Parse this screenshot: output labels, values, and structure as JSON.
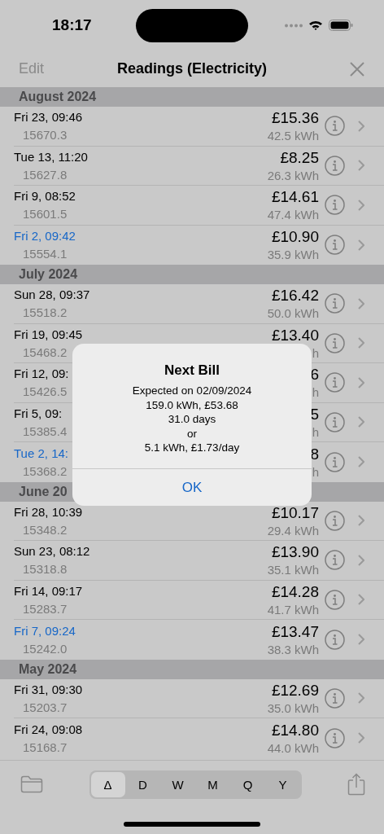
{
  "status_bar": {
    "time": "18:17"
  },
  "nav": {
    "edit": "Edit",
    "title": "Readings (Electricity)"
  },
  "sections": [
    {
      "title": "August 2024",
      "rows": [
        {
          "date": "Fri 23, 09:46",
          "reading": "15670.3",
          "amount": "£15.36",
          "usage": "42.5 kWh",
          "marked": false
        },
        {
          "date": "Tue 13, 11:20",
          "reading": "15627.8",
          "amount": "£8.25",
          "usage": "26.3 kWh",
          "marked": false
        },
        {
          "date": "Fri 9, 08:52",
          "reading": "15601.5",
          "amount": "£14.61",
          "usage": "47.4 kWh",
          "marked": false
        },
        {
          "date": "Fri 2, 09:42",
          "reading": "15554.1",
          "amount": "£10.90",
          "usage": "35.9 kWh",
          "marked": true
        }
      ]
    },
    {
      "title": "July 2024",
      "rows": [
        {
          "date": "Sun 28, 09:37",
          "reading": "15518.2",
          "amount": "£16.42",
          "usage": "50.0 kWh",
          "marked": false
        },
        {
          "date": "Fri 19, 09:45",
          "reading": "15468.2",
          "amount": "£13.40",
          "usage": "h",
          "marked": false
        },
        {
          "date": "Fri 12, 09:",
          "reading": "15426.5",
          "amount": "6",
          "usage": "h",
          "marked": false
        },
        {
          "date": "Fri 5, 09:",
          "reading": "15385.4",
          "amount": "5",
          "usage": "h",
          "marked": false
        },
        {
          "date": "Tue 2, 14:",
          "reading": "15368.2",
          "amount": "8",
          "usage": "h",
          "marked": true
        }
      ]
    },
    {
      "title": "June 20",
      "rows": [
        {
          "date": "Fri 28, 10:39",
          "reading": "15348.2",
          "amount": "£10.17",
          "usage": "29.4 kWh",
          "marked": false
        },
        {
          "date": "Sun 23, 08:12",
          "reading": "15318.8",
          "amount": "£13.90",
          "usage": "35.1 kWh",
          "marked": false
        },
        {
          "date": "Fri 14, 09:17",
          "reading": "15283.7",
          "amount": "£14.28",
          "usage": "41.7 kWh",
          "marked": false
        },
        {
          "date": "Fri 7, 09:24",
          "reading": "15242.0",
          "amount": "£13.47",
          "usage": "38.3 kWh",
          "marked": true
        }
      ]
    },
    {
      "title": "May 2024",
      "rows": [
        {
          "date": "Fri 31, 09:30",
          "reading": "15203.7",
          "amount": "£12.69",
          "usage": "35.0 kWh",
          "marked": false
        },
        {
          "date": "Fri 24, 09:08",
          "reading": "15168.7",
          "amount": "£14.80",
          "usage": "44.0 kWh",
          "marked": false
        }
      ]
    }
  ],
  "alert": {
    "title": "Next Bill",
    "lines": [
      "Expected on 02/09/2024",
      "159.0 kWh, £53.68",
      "31.0 days",
      "or",
      "5.1 kWh, £1.73/day"
    ],
    "button": "OK"
  },
  "toolbar": {
    "segments": [
      {
        "label": "Δ",
        "selected": true
      },
      {
        "label": "D",
        "selected": false
      },
      {
        "label": "W",
        "selected": false
      },
      {
        "label": "M",
        "selected": false
      },
      {
        "label": "Q",
        "selected": false
      },
      {
        "label": "Y",
        "selected": false
      }
    ]
  }
}
